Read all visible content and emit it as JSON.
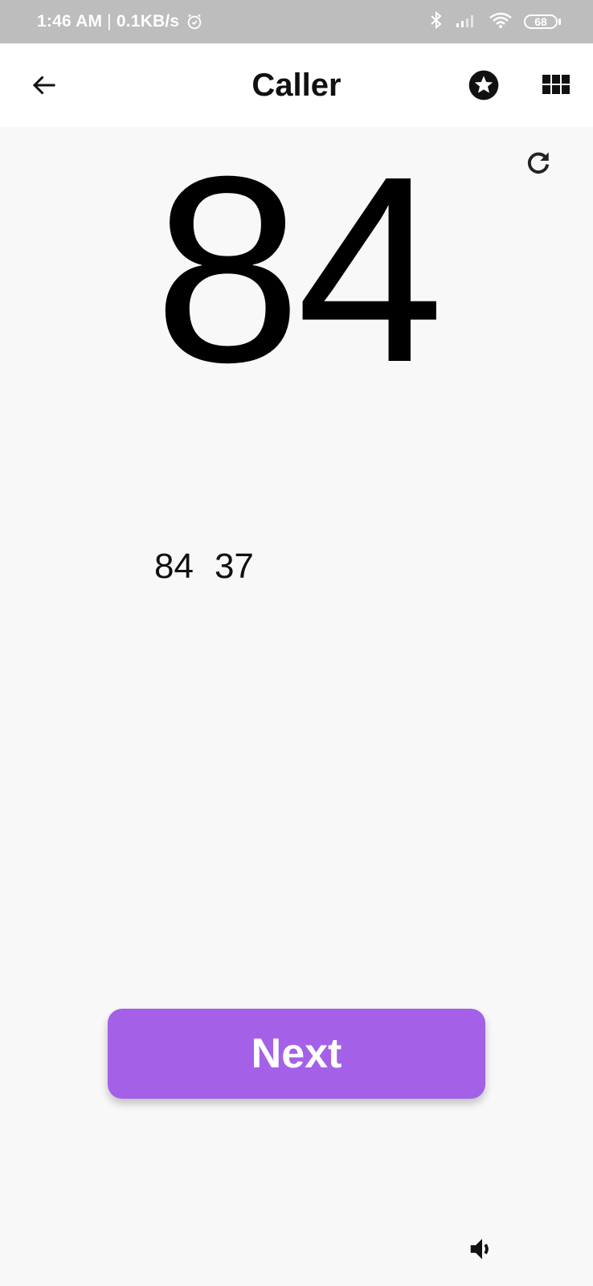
{
  "status_bar": {
    "time": "1:46 AM",
    "separator": "|",
    "network_speed": "0.1KB/s",
    "battery_level": "68",
    "icons": [
      "alarm-icon",
      "bluetooth-icon",
      "signal-icon",
      "wifi-icon",
      "battery-icon"
    ]
  },
  "app_bar": {
    "title": "Caller",
    "back_icon": "arrow-back-icon",
    "star_icon": "star-circle-icon",
    "grid_icon": "grid-icon"
  },
  "caller": {
    "current_number": "84",
    "history": [
      "84",
      "37"
    ],
    "refresh_icon": "refresh-icon"
  },
  "actions": {
    "next_label": "Next",
    "speaker_icon": "volume-icon"
  },
  "colors": {
    "status_bar": "#bdbdbd",
    "app_bar": "#ffffff",
    "background": "#f8f8f8",
    "accent": "#a461e8",
    "text": "#000000"
  }
}
